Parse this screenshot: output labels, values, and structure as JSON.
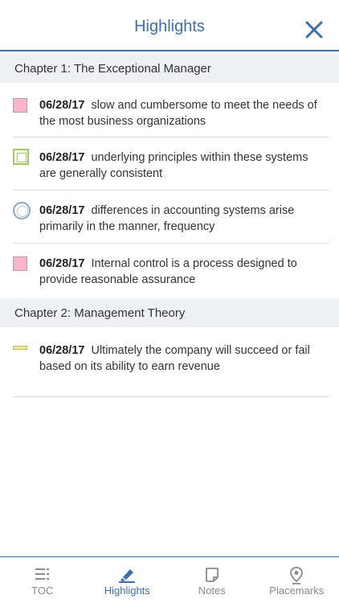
{
  "header": {
    "title": "Highlights",
    "close_icon": "close-icon"
  },
  "chapters": [
    {
      "title": "Chapter 1: The Exceptional Manager",
      "items": [
        {
          "date": "06/28/17",
          "text": "slow and cumbersome to meet the needs of the most business organizations",
          "marker": "pink-square"
        },
        {
          "date": "06/28/17",
          "text": "underlying principles within these systems are generally consistent",
          "marker": "green-square"
        },
        {
          "date": "06/28/17",
          "text": "differences in accounting systems arise primarily in the manner, frequency",
          "marker": "blue-circle"
        },
        {
          "date": "06/28/17",
          "text": "Internal control is a process designed to provide reasonable assurance",
          "marker": "pink-square"
        }
      ]
    },
    {
      "title": "Chapter 2: Management Theory",
      "items": [
        {
          "date": "06/28/17",
          "text": "Ultimately the company will succeed or fail based on its ability to earn revenue",
          "marker": "yellow-underline"
        }
      ]
    }
  ],
  "tabs": [
    {
      "label": "TOC",
      "icon": "toc-list-icon"
    },
    {
      "label": "Highlights",
      "icon": "highlighter-icon",
      "active": true
    },
    {
      "label": "Notes",
      "icon": "note-icon"
    },
    {
      "label": "Placemarks",
      "icon": "location-pin-icon"
    }
  ],
  "colors": {
    "accent": "#3f6fa8",
    "chapter_bg": "#eef1f4",
    "pink": "#f8b7c9",
    "green": "#a8c46a",
    "blue": "#8aa6c8",
    "yellow": "#f0e79b"
  }
}
